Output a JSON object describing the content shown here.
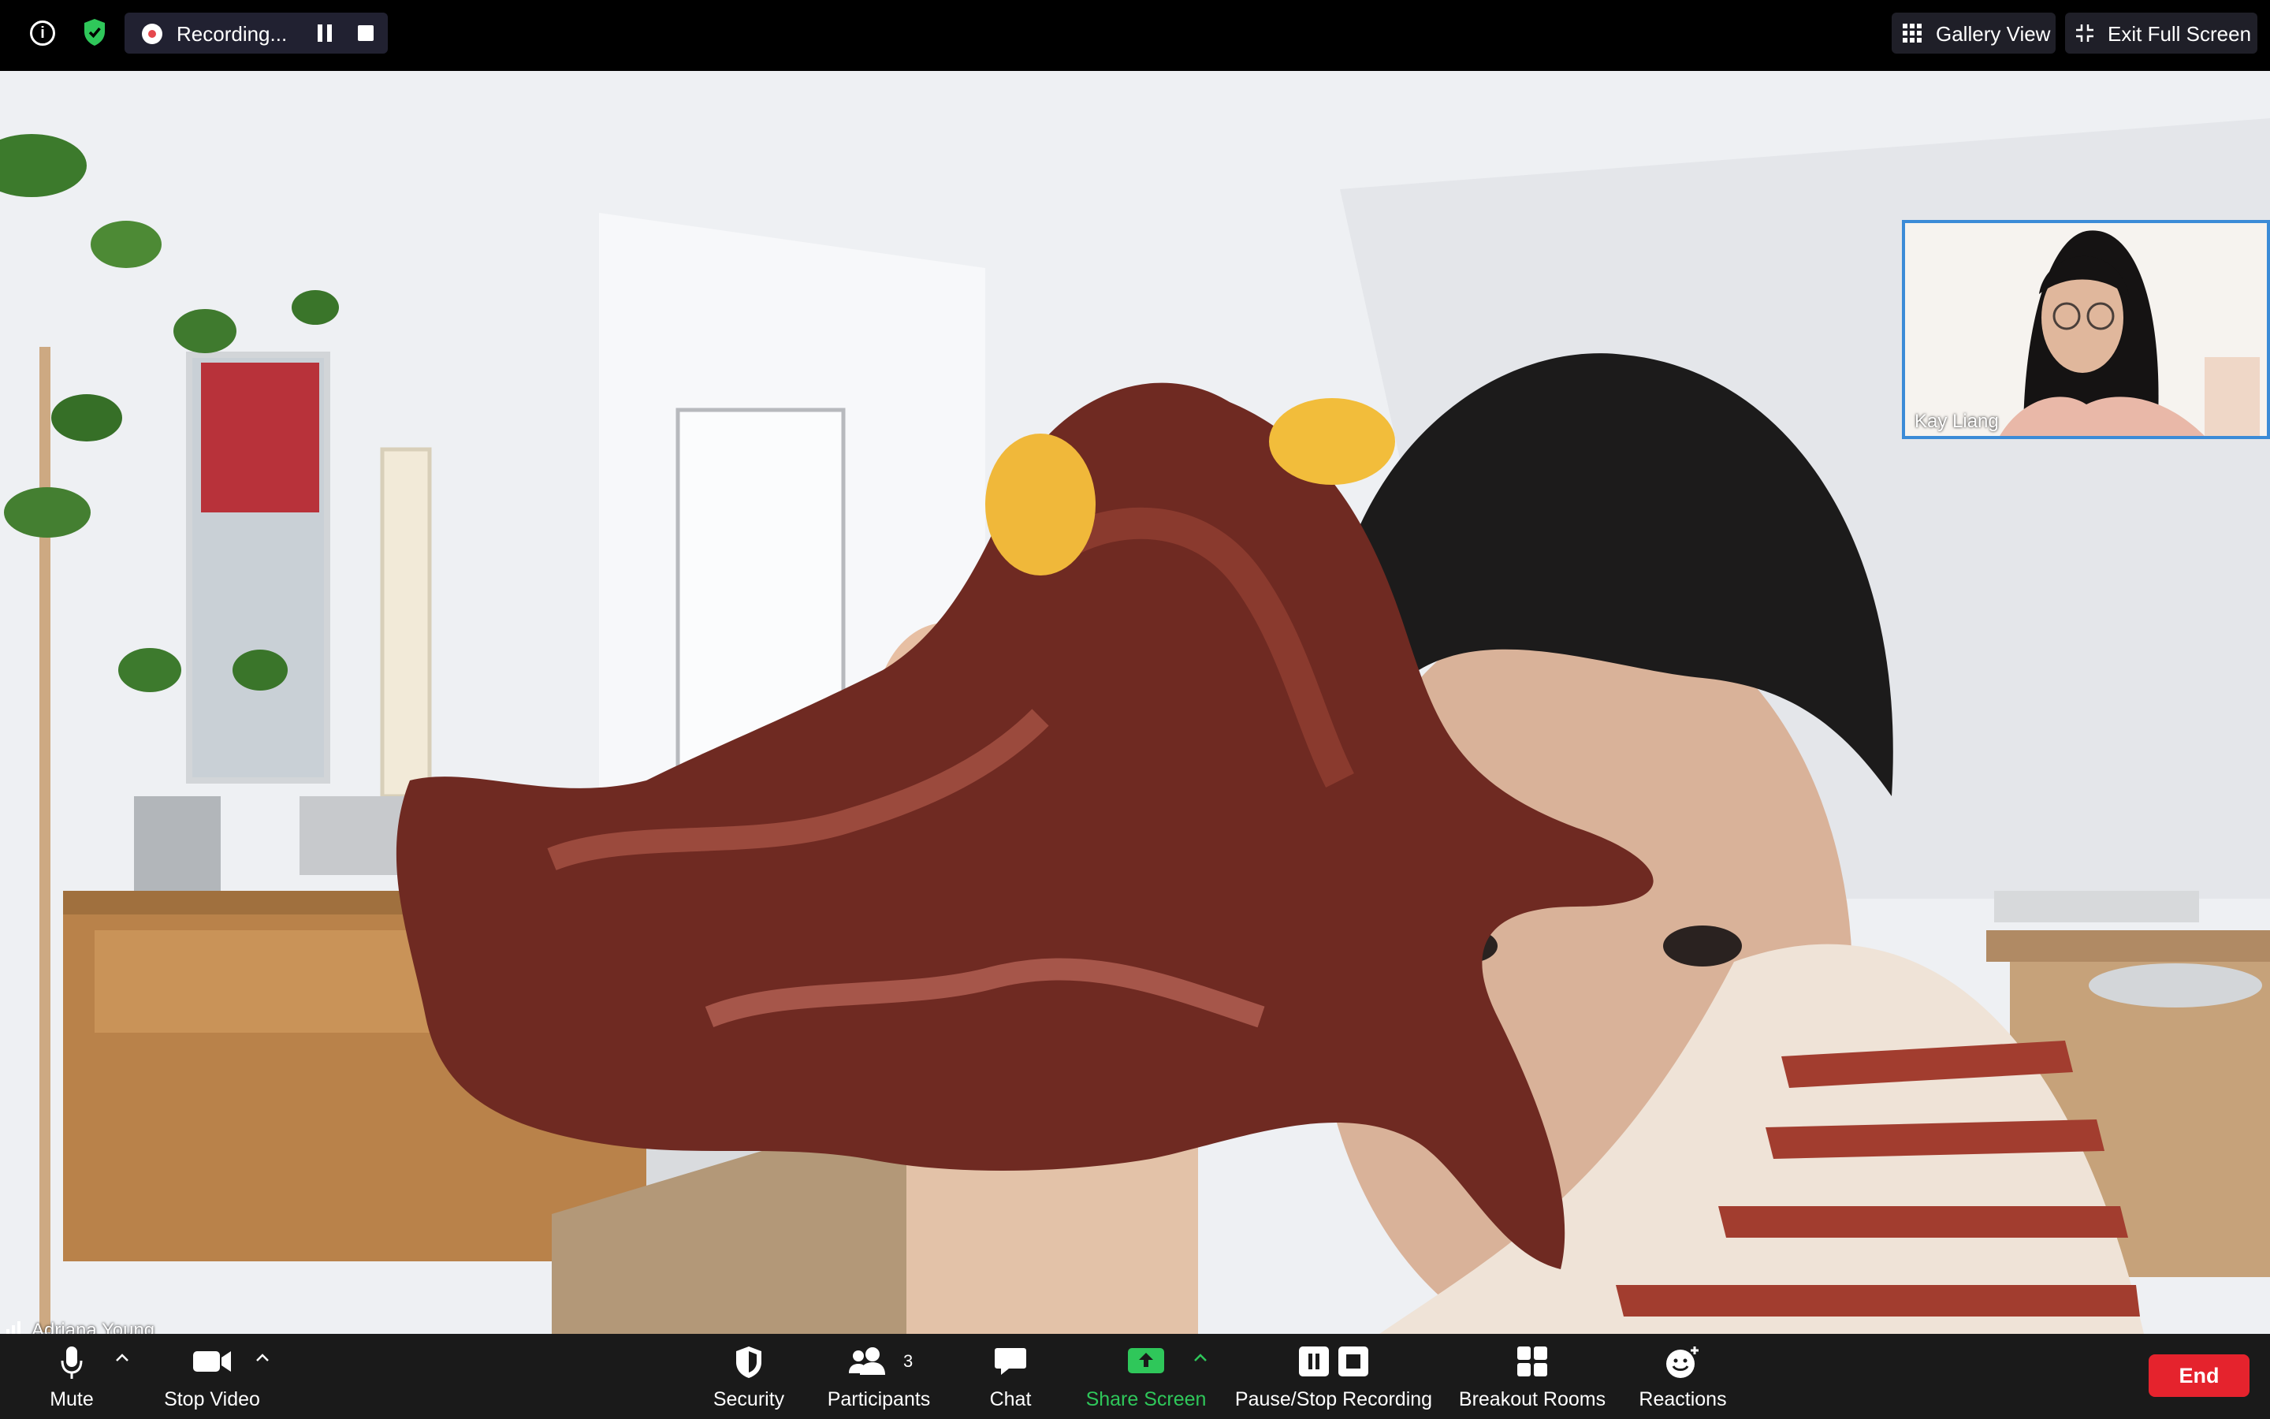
{
  "top_bar": {
    "recording_label": "Recording...",
    "gallery_view_label": "Gallery View",
    "exit_fullscreen_label": "Exit Full Screen",
    "icons": [
      "info-icon",
      "security-shield-icon",
      "record-dot-icon",
      "pause-icon",
      "stop-icon",
      "grid-icon",
      "exit-fullscreen-icon"
    ],
    "shield_color": "#2fc75a"
  },
  "main_video": {
    "speaker_name": "Adriana Young"
  },
  "thumbnail": {
    "name": "Kay Liang",
    "border_color": "#3b8bd7"
  },
  "toolbar": {
    "mute_label": "Mute",
    "stop_video_label": "Stop Video",
    "security_label": "Security",
    "participants_label": "Participants",
    "participants_count": "3",
    "chat_label": "Chat",
    "share_screen_label": "Share Screen",
    "pause_stop_recording_label": "Pause/Stop Recording",
    "breakout_rooms_label": "Breakout Rooms",
    "reactions_label": "Reactions",
    "end_label": "End",
    "share_color": "#2fc75a",
    "end_color": "#e5232d"
  }
}
